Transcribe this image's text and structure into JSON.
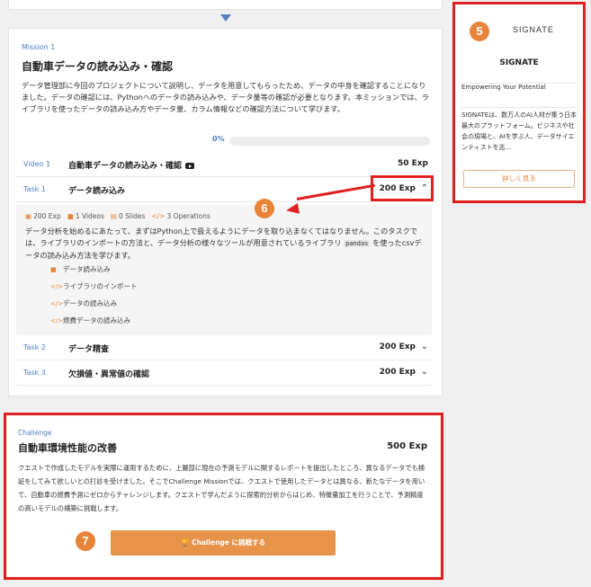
{
  "mission": {
    "tag": "Mission 1",
    "title": "自動車データの読み込み・確認",
    "description": "データ管理部に今回のプロジェクトについて説明し、データを用意してもらったため、データの中身を確認することになりました。データの確認には、Pythonへのデータの読み込みや、データ量等の確認が必要となります。本ミッションでは、ライブラリを使ったデータの読み込み方やデータ量、カラム情報などの確認方法について学びます。",
    "progress": "0%",
    "video": {
      "kind": "Video 1",
      "name": "自動車データの読み込み・確認",
      "exp": "50 Exp",
      "icon": "youtube-icon"
    },
    "tasks": [
      {
        "kind": "Task 1",
        "name": "データ読み込み",
        "exp": "200 Exp",
        "chevron": "⌃"
      },
      {
        "kind": "Task 2",
        "name": "データ精査",
        "exp": "200 Exp",
        "chevron": "⌄"
      },
      {
        "kind": "Task 3",
        "name": "欠損値・異常値の確認",
        "exp": "200 Exp",
        "chevron": "⌄"
      }
    ],
    "task_detail": {
      "meta": [
        "200 Exp",
        "1 Videos",
        "0 Slides",
        "3 Operations"
      ],
      "desc_part1": "データ分析を始めるにあたって、まずはPython上で扱えるようにデータを取り込まなくてはなりません。このタスクでは、ライブラリのインポートの方法と、データ分析の様々なツールが用意されているライブラリ",
      "code": "pandas",
      "desc_part2": "を使ったcsvデータの読み込み方法を学びます。",
      "items": [
        {
          "icon": "video-icon",
          "glyph": "■",
          "label": "データ読み込み"
        },
        {
          "icon": "code-icon",
          "glyph": "</>",
          "label": "ライブラリのインポート"
        },
        {
          "icon": "code-icon",
          "glyph": "</>",
          "label": "データの読み込み"
        },
        {
          "icon": "code-icon",
          "glyph": "</>",
          "label": "燃費データの読み込み"
        }
      ]
    }
  },
  "annotations": {
    "five": "5",
    "six": "6",
    "seven": "7"
  },
  "sidebar": {
    "logo": "SIGNATE",
    "name": "SIGNATE",
    "tagline": "Empowering Your Potential",
    "description": "SIGNATEは、数万人のAI人材が集う日本最大のプラットフォーム。ビジネスや社会の現場と、AIを学ぶ人、データサイエンティストを志...",
    "more_label": "詳しく見る"
  },
  "challenge": {
    "tag": "Challenge",
    "title": "自動車環境性能の改善",
    "exp": "500 Exp",
    "description": "クエストで作成したモデルを実際に運用するために、上層部に現在の予測モデルに関するレポートを提出したところ、異なるデータでも検証をしてみて欲しいとの打診を受けました。そこでChallenge Missionでは、クエストで使用したデータとは異なる、新たなデータを用いて、自動車の燃費予測にゼロからチャレンジします。クエストで学んだように探索的分析からはじめ、特徴量加工を行うことで、予測精度の高いモデルの構築に挑戦します。",
    "button_label": "🏆 Challenge に挑戦する"
  },
  "colors": {
    "accent": "#e8833a",
    "link": "#4f7fc2",
    "annotation": "#e02020"
  }
}
